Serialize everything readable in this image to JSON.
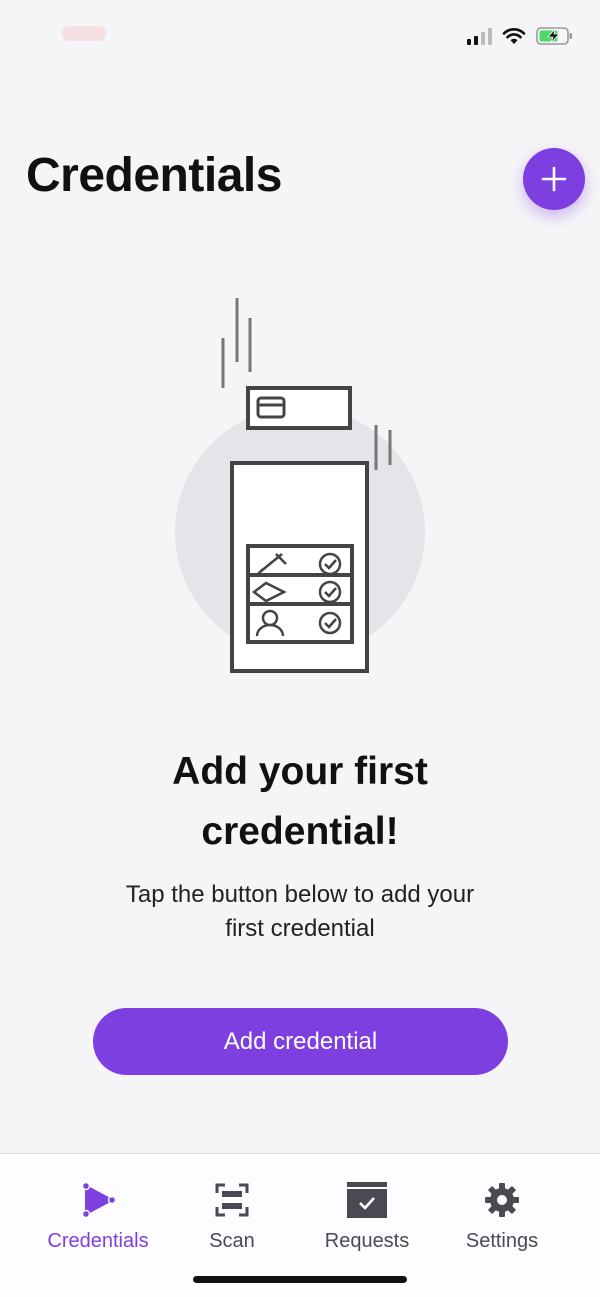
{
  "status_bar": {
    "icons": [
      "signal-icon",
      "wifi-icon",
      "battery-charging-icon"
    ]
  },
  "header": {
    "title": "Credentials",
    "add_icon": "plus-icon"
  },
  "empty_state": {
    "title_line1": "Add your first",
    "title_line2": "credential!",
    "subtitle_line1": "Tap the button below to add your",
    "subtitle_line2": "first credential",
    "button_label": "Add credential"
  },
  "tab_bar": {
    "tabs": [
      {
        "label": "Credentials",
        "icon": "credentials-icon",
        "active": true
      },
      {
        "label": "Scan",
        "icon": "scan-icon",
        "active": false
      },
      {
        "label": "Requests",
        "icon": "requests-icon",
        "active": false
      },
      {
        "label": "Settings",
        "icon": "gear-icon",
        "active": false
      }
    ]
  },
  "colors": {
    "accent": "#7e3fe0",
    "background": "#f5f4f7",
    "tab_inactive": "#4a4a52"
  }
}
